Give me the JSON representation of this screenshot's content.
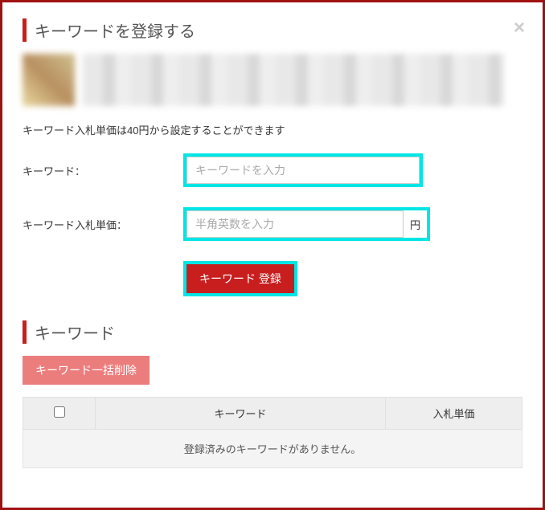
{
  "modal": {
    "title": "キーワードを登録する",
    "info_text": "キーワード入札単価は40円から設定することができます",
    "close_glyph": "×"
  },
  "form": {
    "keyword_label": "キーワード：",
    "keyword_placeholder": "キーワードを入力",
    "bid_label": "キーワード入札単価：",
    "bid_placeholder": "半角英数を入力",
    "bid_unit": "円",
    "submit_label": "キーワード 登録"
  },
  "list_section": {
    "title": "キーワード",
    "delete_all_label": "キーワード一括削除",
    "columns": {
      "keyword": "キーワード",
      "bid": "入札単価"
    },
    "empty_message": "登録済みのキーワードがありません。"
  }
}
